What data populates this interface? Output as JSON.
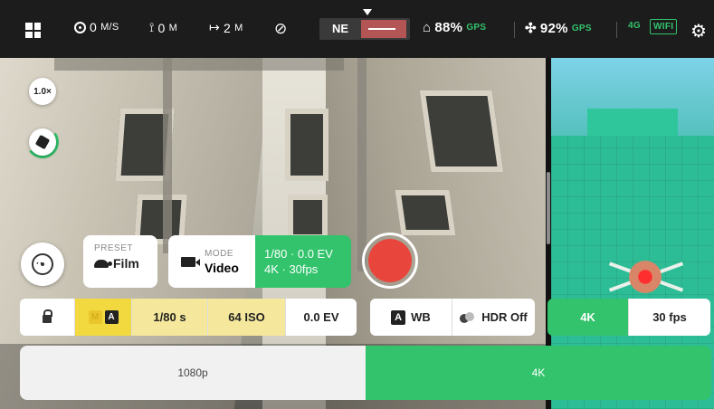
{
  "status_bar": {
    "speed": {
      "value": "0",
      "unit": "M/S"
    },
    "altitude": {
      "value": "0",
      "unit": "M"
    },
    "distance": {
      "value": "2",
      "unit": "M"
    },
    "heading_label": "NE",
    "controller_battery": "88%",
    "controller_gps": "GPS",
    "drone_battery": "92%",
    "drone_gps": "GPS",
    "network": "4G",
    "wifi": "WIFI"
  },
  "left_controls": {
    "zoom": "1.0×"
  },
  "preset": {
    "label": "PRESET",
    "value": "Film"
  },
  "mode": {
    "label": "MODE",
    "value": "Video"
  },
  "exposure_summary": {
    "line1": "1/80 · 0.0 EV",
    "line2": "4K · 30fps"
  },
  "settings_left": {
    "auto_badge": "A",
    "manual_badge": "M",
    "shutter": "1/80 s",
    "iso": "64 ISO",
    "ev": "0.0 EV"
  },
  "settings_mid": {
    "wb_badge": "A",
    "wb": "WB",
    "hdr": "HDR Off"
  },
  "settings_right": {
    "resolution": "4K",
    "framerate": "30 fps"
  },
  "resolution_toggle": {
    "options": [
      "1080p",
      "4K"
    ],
    "selected": "4K"
  },
  "colors": {
    "accent_green": "#32c36c",
    "record_red": "#e8463c",
    "manual_yellow": "#f2d93f"
  },
  "icons": [
    "grid-icon",
    "speed-icon",
    "altitude-icon",
    "distance-icon",
    "no-fly-icon",
    "controller-icon",
    "drone-icon",
    "gear-icon",
    "gimbal-icon",
    "joystick-icon",
    "turtle-icon",
    "video-camera-icon",
    "lock-icon",
    "hdr-icon"
  ]
}
